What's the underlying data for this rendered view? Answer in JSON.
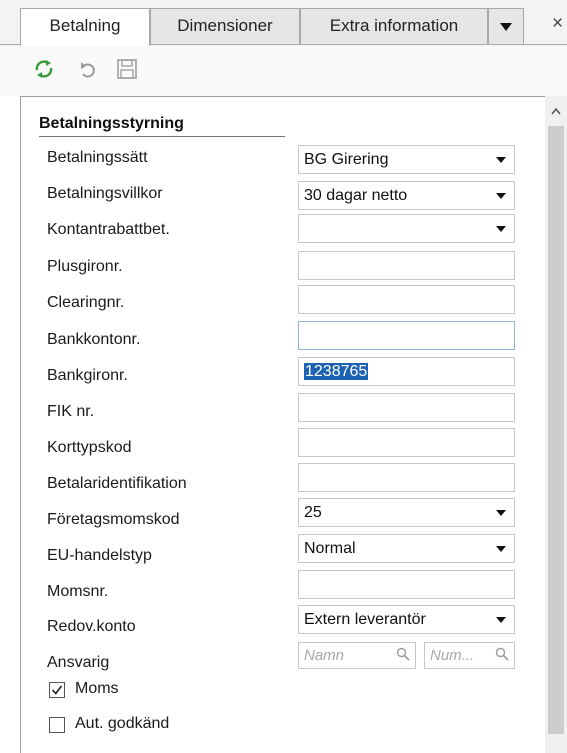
{
  "tabs": [
    {
      "label": "Betalning",
      "active": true
    },
    {
      "label": "Dimensioner",
      "active": false
    },
    {
      "label": "Extra information",
      "active": false
    }
  ],
  "tab_overflow_icon": "dropdown-arrow",
  "close_symbol": "×",
  "toolbar_icons": [
    "refresh-icon",
    "undo-icon",
    "save-icon"
  ],
  "section": {
    "title": "Betalningsstyrning"
  },
  "form": {
    "betalningssatt": {
      "label": "Betalningssätt",
      "value": "BG Girering"
    },
    "betalningsvillkor": {
      "label": "Betalningsvillkor",
      "value": "30 dagar netto"
    },
    "kontantrabattbet": {
      "label": "Kontantrabattbet.",
      "value": ""
    },
    "plusgironr": {
      "label": "Plusgironr.",
      "value": ""
    },
    "clearingnr": {
      "label": "Clearingnr.",
      "value": ""
    },
    "bankkontonr": {
      "label": "Bankkontonr.",
      "value": ""
    },
    "bankgironr": {
      "label": "Bankgironr.",
      "value": "1238765"
    },
    "fiknr": {
      "label": "FIK nr.",
      "value": ""
    },
    "korttypskod": {
      "label": "Korttypskod",
      "value": ""
    },
    "betalaridentifikation": {
      "label": "Betalaridentifikation",
      "value": ""
    },
    "foretagsmomskod": {
      "label": "Företagsmomskod",
      "value": "25"
    },
    "euhandelstyp": {
      "label": "EU-handelstyp",
      "value": "Normal"
    },
    "momsnr": {
      "label": "Momsnr.",
      "value": ""
    },
    "redovkonto": {
      "label": "Redov.konto",
      "value": "Extern leverantör"
    },
    "ansvarig": {
      "label": "Ansvarig",
      "placeholder_name": "Namn",
      "placeholder_num": "Num..."
    }
  },
  "checkboxes": {
    "moms": {
      "label": "Moms",
      "checked": true
    },
    "autgodkand": {
      "label": "Aut. godkänd",
      "checked": false
    }
  },
  "colors": {
    "selection": "#1e63b3",
    "refresh_icon": "#3a9a3a",
    "focus_border": "#8fb3d9"
  }
}
